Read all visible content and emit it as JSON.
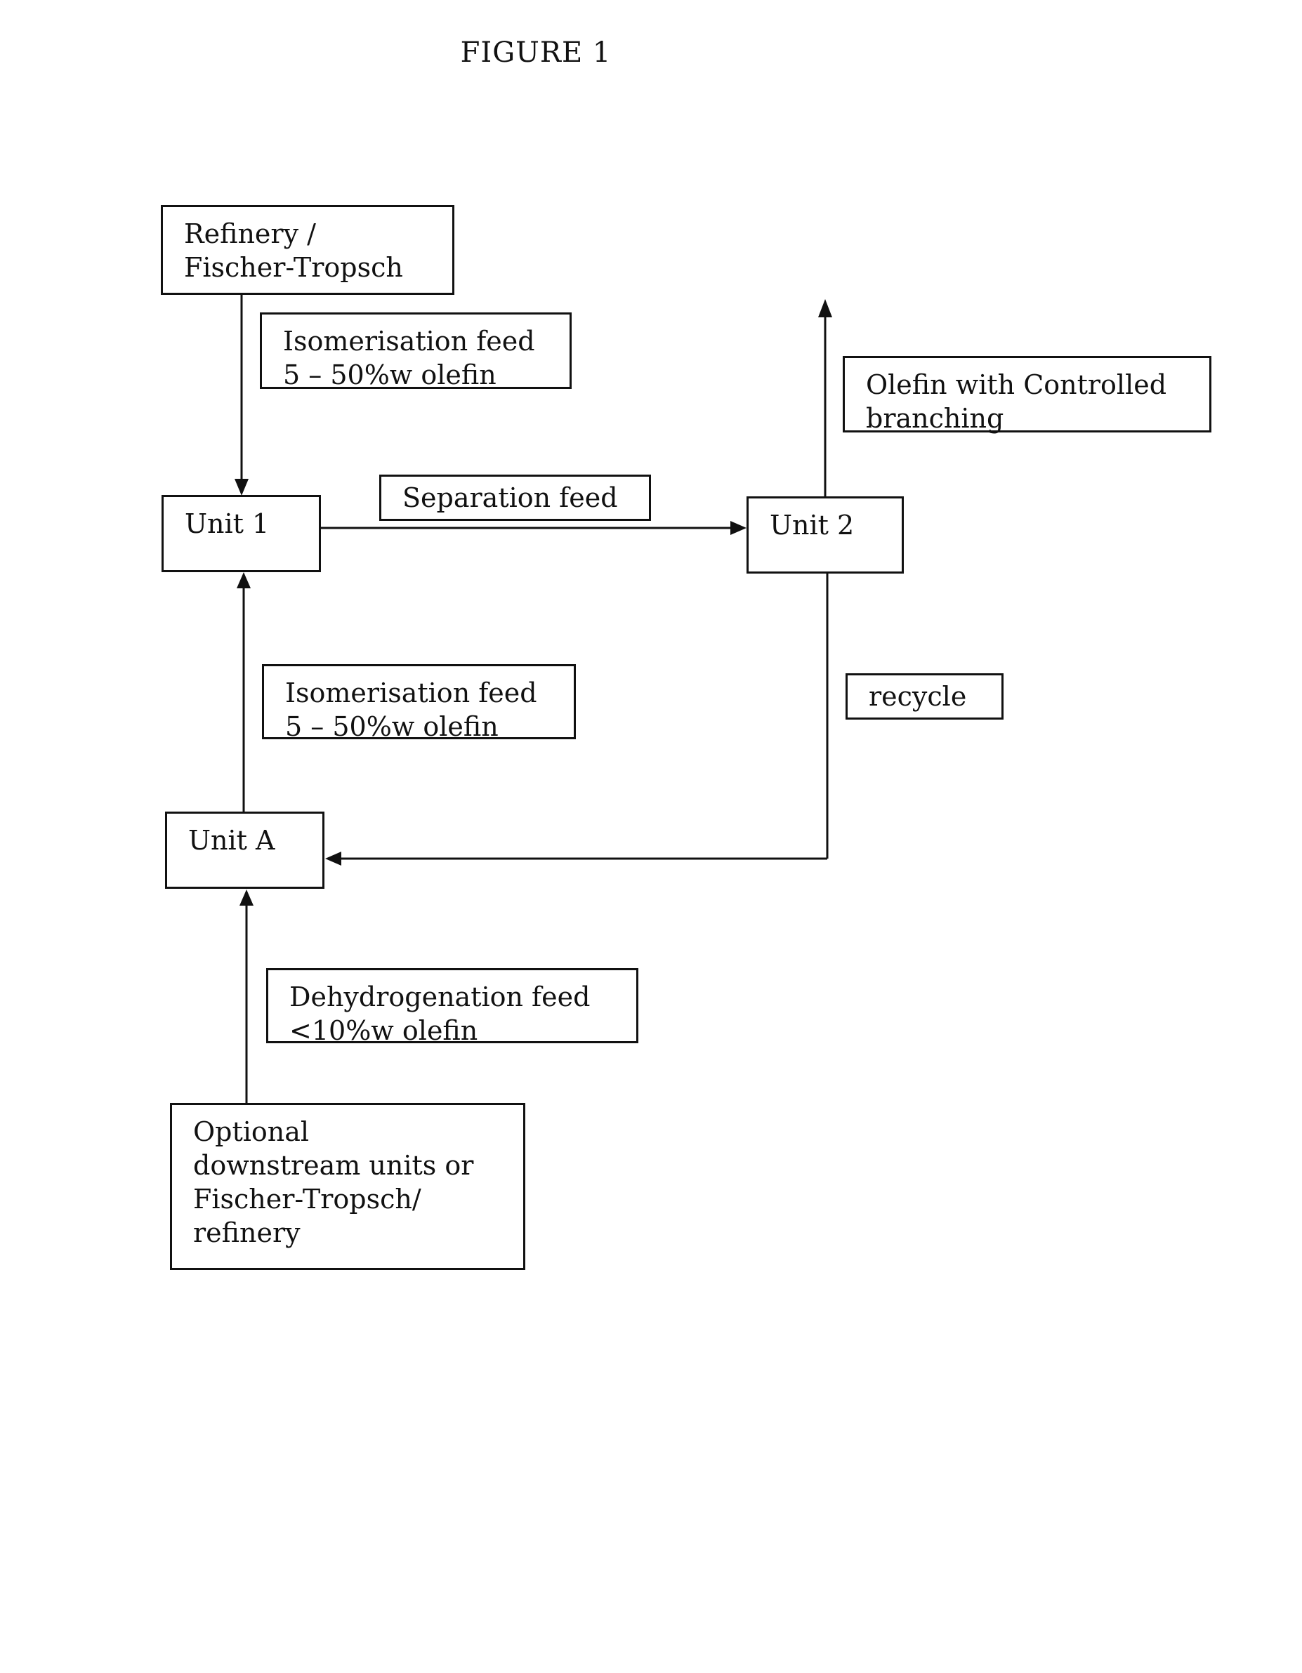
{
  "figure": {
    "title": "FIGURE 1"
  },
  "nodes": {
    "refinery": {
      "lines": [
        "Refinery /",
        "Fischer-Tropsch"
      ]
    },
    "unit_1": {
      "lines": [
        "Unit 1"
      ]
    },
    "unit_2": {
      "lines": [
        "Unit 2"
      ]
    },
    "unit_a": {
      "lines": [
        "Unit A"
      ]
    },
    "optional": {
      "lines": [
        "Optional",
        "downstream units or",
        "Fischer-Tropsch/",
        "refinery"
      ]
    }
  },
  "labels": {
    "isomerisation_feed_top": {
      "lines": [
        "Isomerisation feed",
        "5 – 50%w olefin"
      ]
    },
    "separation_feed": {
      "lines": [
        "Separation feed"
      ]
    },
    "olefin_output": {
      "lines": [
        "Olefin with Controlled",
        "branching"
      ]
    },
    "isomerisation_feed_bottom": {
      "lines": [
        "Isomerisation feed",
        "5 – 50%w olefin"
      ]
    },
    "recycle": {
      "lines": [
        "recycle"
      ]
    },
    "dehydrogenation_feed": {
      "lines": [
        "Dehydrogenation feed",
        "<10%w olefin"
      ]
    }
  },
  "edges": [
    {
      "from": "refinery",
      "to": "unit_1",
      "label": "isomerisation_feed_top"
    },
    {
      "from": "unit_1",
      "to": "unit_2",
      "label": "separation_feed"
    },
    {
      "from": "unit_2",
      "to": "output",
      "label": "olefin_output"
    },
    {
      "from": "unit_2",
      "to": "unit_a",
      "label": "recycle"
    },
    {
      "from": "unit_a",
      "to": "unit_1",
      "label": "isomerisation_feed_bottom"
    },
    {
      "from": "optional",
      "to": "unit_a",
      "label": "dehydrogenation_feed"
    }
  ]
}
